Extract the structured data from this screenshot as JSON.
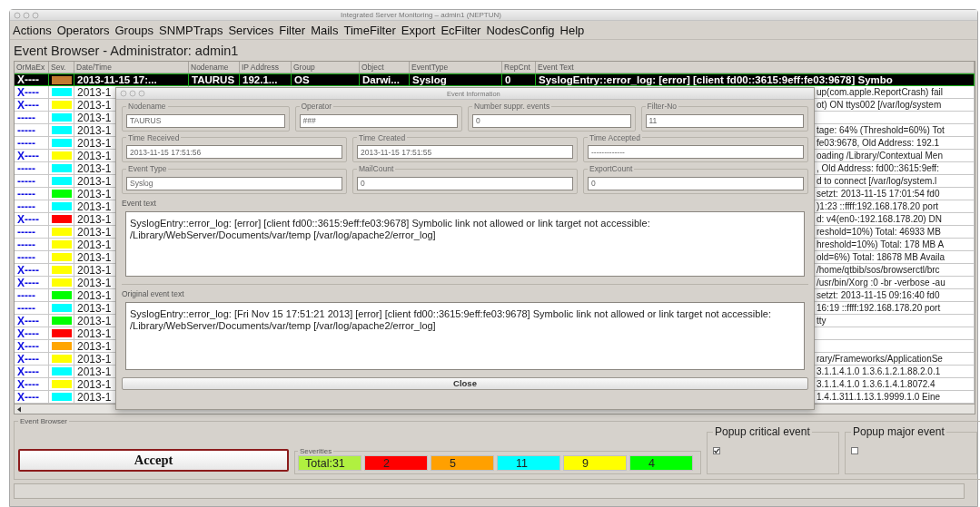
{
  "window": {
    "title": "Integrated Server Monitoring – admin1 (NEPTUN)"
  },
  "menu": [
    "Actions",
    "Operators",
    "Groups",
    "SNMPTraps",
    "Services",
    "Filter",
    "Mails",
    "TimeFilter",
    "Export",
    "EcFilter",
    "NodesConfig",
    "Help"
  ],
  "heading": "Event Browser - Administrator: admin1",
  "table": {
    "columns": [
      "OrMaEx",
      "Sev.",
      "Date/Time",
      "Nodename",
      "IP Address",
      "Group",
      "Object",
      "EventType",
      "RepCnt",
      "Event Text"
    ],
    "rows": [
      {
        "or_ma_ex": "X----",
        "color": "#c27a30",
        "date_time": "2013-11-15 17:...",
        "nodename": "TAURUS",
        "ip_address": "192.1...",
        "group": "OS",
        "object": "Darwi...",
        "event_type": "Syslog",
        "rep_cnt": "0",
        "event_text": "SyslogEntry::error_log: [error] [client fd00::3615:9eff:fe03:9678] Symbo",
        "selected": true
      },
      {
        "or_ma_ex": "X----",
        "color": "#00ffff",
        "date_time": "2013-1",
        "event_text": "up(com.apple.ReportCrash) fail",
        "selected": false
      },
      {
        "or_ma_ex": "X----",
        "color": "#ffff00",
        "date_time": "2013-1",
        "event_text": "ot) ON ttys002 [/var/log/system",
        "selected": false
      },
      {
        "or_ma_ex": "-----",
        "color": "#00ffff",
        "date_time": "2013-1",
        "selected": false
      },
      {
        "or_ma_ex": "-----",
        "color": "#00ffff",
        "date_time": "2013-1",
        "event_text": "tage: 64% (Threshold=60%) Tot",
        "selected": false
      },
      {
        "or_ma_ex": "-----",
        "color": "#00ffff",
        "date_time": "2013-1",
        "event_text": "fe03:9678, Old Address: 192.1",
        "selected": false
      },
      {
        "or_ma_ex": "X----",
        "color": "#ffff00",
        "date_time": "2013-1",
        "event_text": "oading /Library/Contextual Men",
        "selected": false
      },
      {
        "or_ma_ex": "-----",
        "color": "#00ffff",
        "date_time": "2013-1",
        "event_text": ", Old Address: fd00::3615:9eff:",
        "selected": false
      },
      {
        "or_ma_ex": "-----",
        "color": "#00ffff",
        "date_time": "2013-1",
        "event_text": "d to connect [/var/log/system.l",
        "selected": false
      },
      {
        "or_ma_ex": "-----",
        "color": "#00ff00",
        "date_time": "2013-1",
        "event_text": "setzt: 2013-11-15 17:01:54 fd0",
        "selected": false
      },
      {
        "or_ma_ex": "-----",
        "color": "#00ffff",
        "date_time": "2013-1",
        "event_text": ")1:23 ::ffff:192.168.178.20 port",
        "selected": false
      },
      {
        "or_ma_ex": "X----",
        "color": "#ff0000",
        "date_time": "2013-1",
        "event_text": "d: v4(en0-:192.168.178.20) DN",
        "selected": false
      },
      {
        "or_ma_ex": "-----",
        "color": "#ffff00",
        "date_time": "2013-1",
        "event_text": "reshold=10%) Total: 46933 MB",
        "selected": false
      },
      {
        "or_ma_ex": "-----",
        "color": "#ffff00",
        "date_time": "2013-1",
        "event_text": "hreshold=10%) Total: 178 MB A",
        "selected": false
      },
      {
        "or_ma_ex": "-----",
        "color": "#ffff00",
        "date_time": "2013-1",
        "event_text": "old=6%) Total: 18678 MB Availa",
        "selected": false
      },
      {
        "or_ma_ex": "X----",
        "color": "#ffff00",
        "date_time": "2013-1",
        "event_text": "/home/qtbib/sos/browserctl/brc",
        "selected": false
      },
      {
        "or_ma_ex": "X----",
        "color": "#ffff00",
        "date_time": "2013-1",
        "event_text": "/usr/bin/Xorg :0 -br -verbose -au",
        "selected": false
      },
      {
        "or_ma_ex": "-----",
        "color": "#00ff00",
        "date_time": "2013-1",
        "event_text": "setzt: 2013-11-15 09:16:40 fd0",
        "selected": false
      },
      {
        "or_ma_ex": "-----",
        "color": "#00ffff",
        "date_time": "2013-1",
        "event_text": "16:19 ::ffff:192.168.178.20 port",
        "selected": false
      },
      {
        "or_ma_ex": "X----",
        "color": "#00ff00",
        "date_time": "2013-1",
        "event_text": "tty",
        "selected": false
      },
      {
        "or_ma_ex": "X----",
        "color": "#ff0000",
        "date_time": "2013-1",
        "selected": false
      },
      {
        "or_ma_ex": "X----",
        "color": "#ffa500",
        "date_time": "2013-1",
        "selected": false
      },
      {
        "or_ma_ex": "X----",
        "color": "#ffff00",
        "date_time": "2013-1",
        "event_text": "rary/Frameworks/ApplicationSe",
        "selected": false
      },
      {
        "or_ma_ex": "X----",
        "color": "#00ffff",
        "date_time": "2013-1",
        "event_text": "3.1.1.4.1.0 1.3.6.1.2.1.88.2.0.1",
        "selected": false
      },
      {
        "or_ma_ex": "X----",
        "color": "#ffff00",
        "date_time": "2013-1",
        "event_text": "3.1.1.4.1.0 1.3.6.1.4.1.8072.4",
        "selected": false
      },
      {
        "or_ma_ex": "X----",
        "color": "#00ffff",
        "date_time": "2013-1",
        "event_text": "1.4.1.311.1.13.1.9999.1.0 Eine",
        "selected": false
      }
    ]
  },
  "dialog": {
    "title": "Event Information",
    "field_rows": [
      [
        {
          "label": "Nodename",
          "value": "TAURUS"
        },
        {
          "label": "Operator",
          "value": "###"
        },
        {
          "label": "Number suppr. events",
          "value": "0"
        },
        {
          "label": "Filter-No",
          "value": "11"
        }
      ],
      [
        {
          "label": "Time Received",
          "value": "2013-11-15 17:51:56"
        },
        {
          "label": "Time Created",
          "value": "2013-11-15 17:51:55"
        },
        {
          "label": "Time Accepted",
          "value": "-------------"
        }
      ],
      [
        {
          "label": "Event Type",
          "value": "Syslog"
        },
        {
          "label": "MailCount",
          "value": "0"
        },
        {
          "label": "ExportCount",
          "value": "0"
        }
      ]
    ],
    "event_text": {
      "label": "Event text",
      "value": "SyslogEntry::error_log: [error] [client fd00::3615:9eff:fe03:9678] Symbolic link not allowed or link target not accessible: /Library/WebServer/Documents/var/temp [/var/log/apache2/error_log]"
    },
    "original_event_text": {
      "label": "Original event text",
      "value": "SyslogEntry::error_log: [Fri Nov 15 17:51:21 2013] [error] [client fd00::3615:9eff:fe03:9678] Symbolic link not allowed or link target not accessible: /Library/WebServer/Documents/var/temp [/var/log/apache2/error_log]"
    },
    "close_button": "Close"
  },
  "event_browser": {
    "label": "Event Browser",
    "accept_button": "Accept",
    "severities": {
      "label": "Severities",
      "items": [
        {
          "text": "Total:31",
          "color": "#b0f040"
        },
        {
          "text": "2",
          "color": "#ff0000"
        },
        {
          "text": "5",
          "color": "#ffa000"
        },
        {
          "text": "11",
          "color": "#00ffff"
        },
        {
          "text": "9",
          "color": "#ffff00"
        },
        {
          "text": "4",
          "color": "#00ff00"
        }
      ]
    },
    "popups": [
      {
        "label": "Popup critical event",
        "checked": true
      },
      {
        "label": "Popup major event",
        "checked": false
      }
    ]
  }
}
